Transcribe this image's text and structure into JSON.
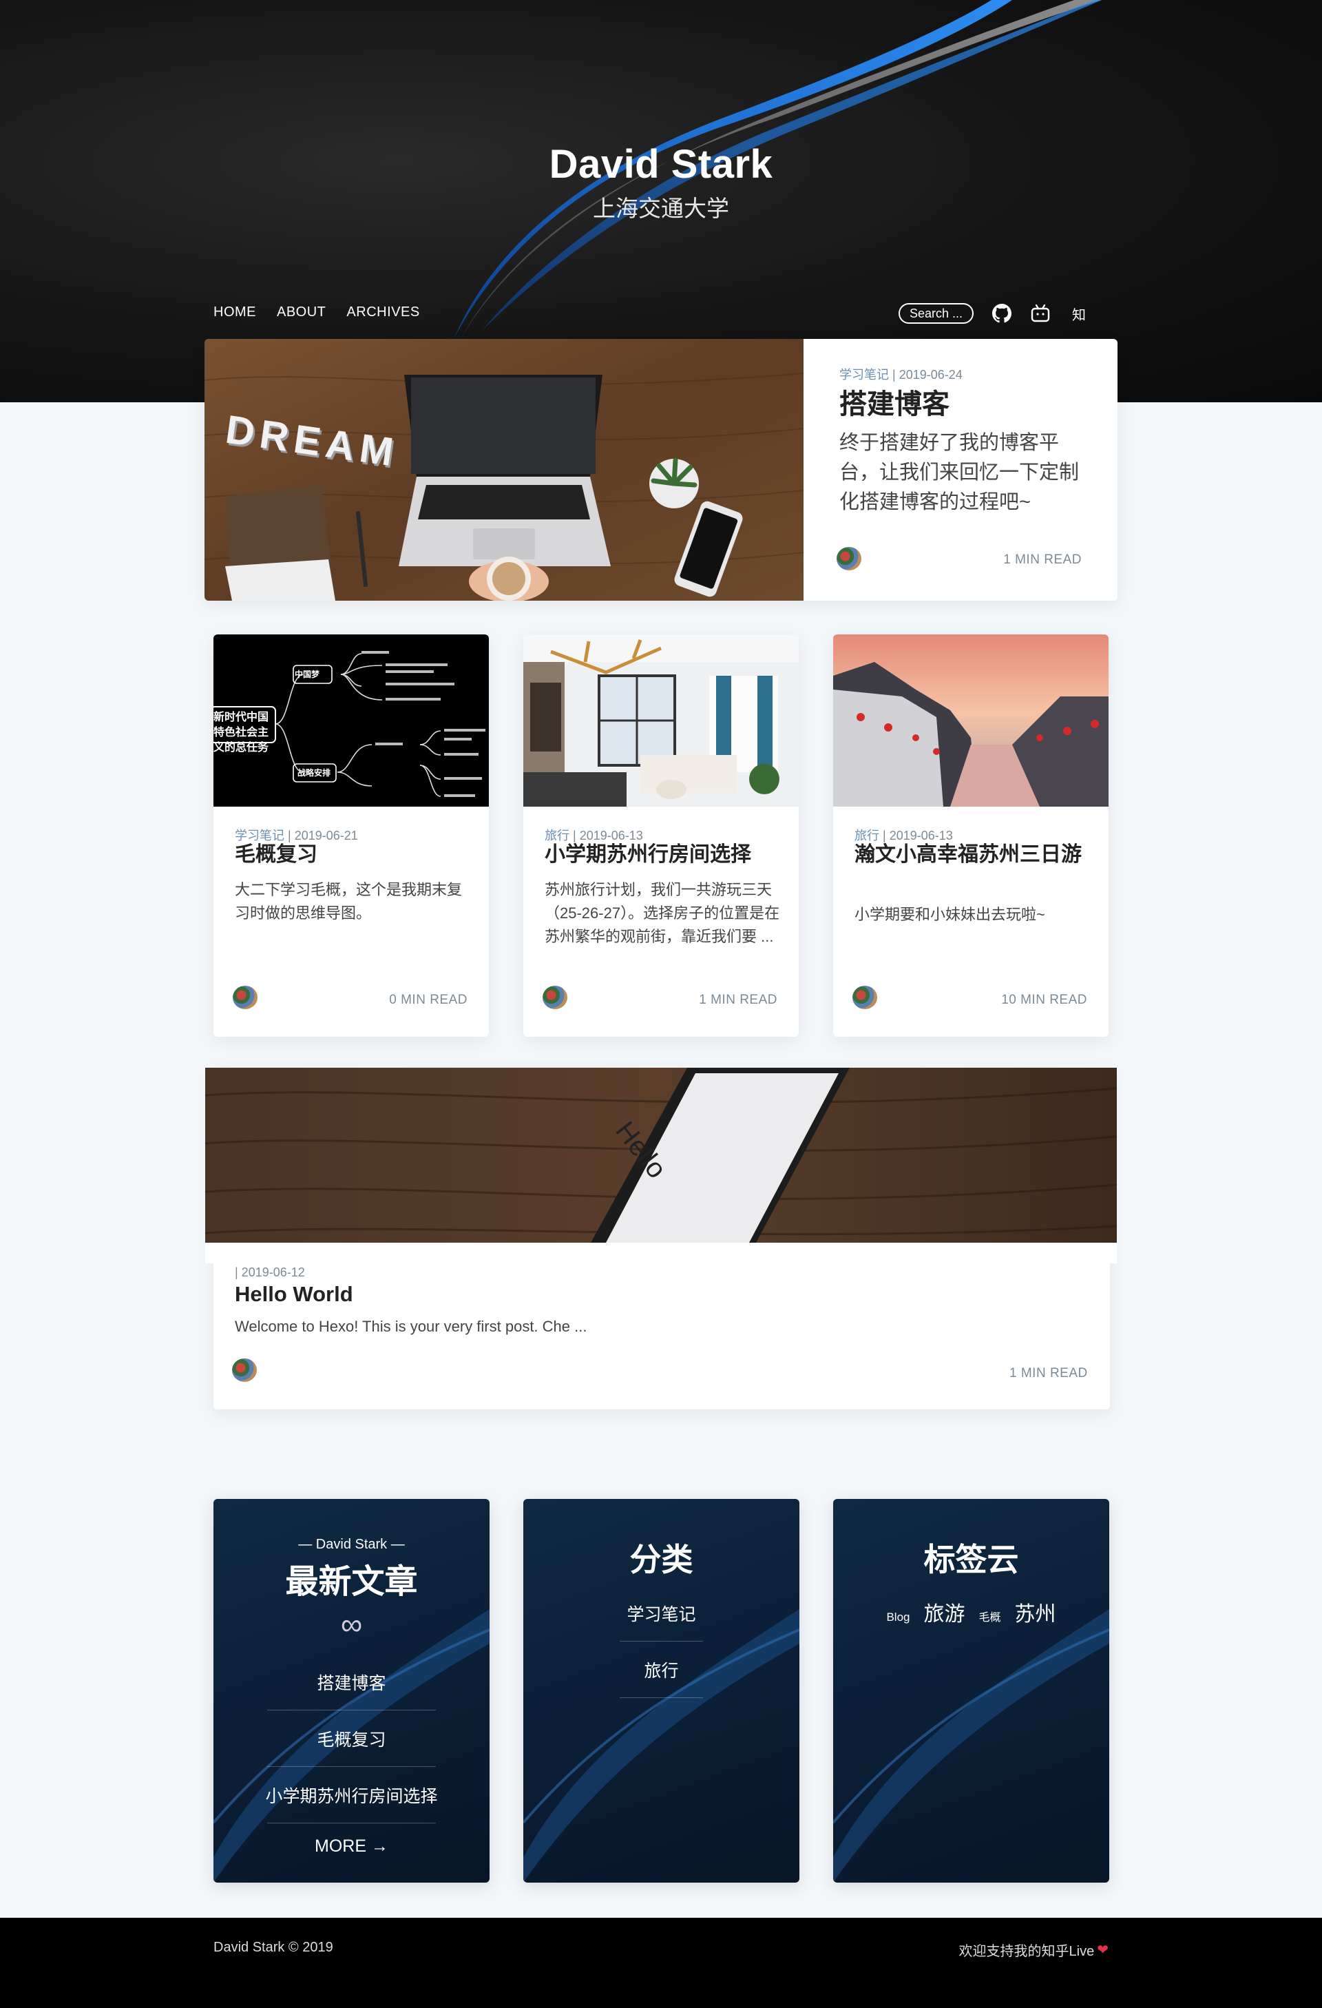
{
  "site": {
    "title": "David Stark",
    "subtitle": "上海交通大学"
  },
  "nav": {
    "home": "HOME",
    "about": "ABOUT",
    "archives": "ARCHIVES",
    "search": "Search ..."
  },
  "nav_icons": {
    "github": "github-icon",
    "bilibili": "bilibili-icon",
    "zhihu": "知"
  },
  "featured": {
    "category": "学习笔记",
    "date": "| 2019-06-24",
    "title": "搭建博客",
    "excerpt": "终于搭建好了我的博客平台，让我们来回忆一下定制化搭建博客的过程吧~",
    "read": "1 MIN READ",
    "image_words": "DREAM"
  },
  "posts": [
    {
      "category": "学习笔记",
      "date": "| 2019-06-21",
      "title": "毛概复习",
      "excerpt": "大二下学习毛概，这个是我期末复习时做的思维导图。",
      "read": "0 MIN READ",
      "mindmap": {
        "center": "新时代中国特色社会主义的总任务",
        "n1": "中国梦",
        "n2": "战略安排"
      }
    },
    {
      "category": "旅行",
      "date": "| 2019-06-13",
      "title": "小学期苏州行房间选择",
      "excerpt": "苏州旅行计划，我们一共游玩三天（25-26-27）。选择房子的位置是在苏州繁华的观前街，靠近我们要 ...",
      "read": "1 MIN READ"
    },
    {
      "category": "旅行",
      "date": "| 2019-06-13",
      "title": "瀚文小高幸福苏州三日游",
      "excerpt": "小学期要和小妹妹出去玩啦~",
      "read": "10 MIN READ"
    }
  ],
  "hello": {
    "date": "| 2019-06-12",
    "title": "Hello World",
    "excerpt": "Welcome to Hexo! This is your very first post. Che ...",
    "read": "1 MIN READ",
    "phone_text": "Hello"
  },
  "widgets": {
    "recent": {
      "author": "— David Stark —",
      "title": "最新文章",
      "symbol": "∞",
      "items": [
        "搭建博客",
        "毛概复习",
        "小学期苏州行房间选择"
      ],
      "more": "MORE →"
    },
    "categories": {
      "title": "分类",
      "items": [
        "学习笔记",
        "旅行"
      ]
    },
    "tags": {
      "title": "标签云",
      "items": [
        "Blog",
        "旅游",
        "毛概",
        "苏州"
      ]
    }
  },
  "footer": {
    "left": "David Stark © 2019",
    "right": "欢迎支持我的知乎Live",
    "heart": "❤"
  },
  "colors": {
    "accent": "#1e6fd0",
    "meta": "#7c8a96",
    "widget_bg": "#0b2038",
    "footer_bg": "#000000"
  }
}
